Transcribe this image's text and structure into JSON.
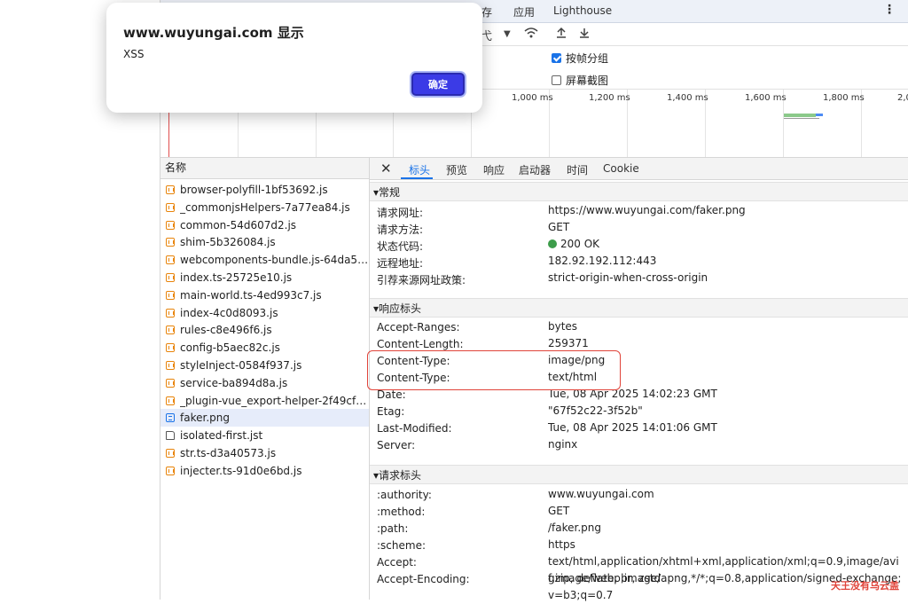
{
  "tabbar": {
    "tabs": [
      "存",
      "应用",
      "Lighthouse"
    ]
  },
  "options": {
    "group_by_frame": "按帧分组",
    "screenshots": "屏幕截图"
  },
  "timeline": {
    "ticks": [
      "1,000 ms",
      "1,200 ms",
      "1,400 ms",
      "1,600 ms",
      "1,800 ms",
      "2,0"
    ]
  },
  "request_list": {
    "header": "名称",
    "selected_index": 13,
    "items": [
      {
        "name": "browser-polyfill-1bf53692.js",
        "icon": "js-file-icon"
      },
      {
        "name": "_commonjsHelpers-7a77ea84.js",
        "icon": "js-file-icon"
      },
      {
        "name": "common-54d607d2.js",
        "icon": "js-file-icon"
      },
      {
        "name": "shim-5b326084.js",
        "icon": "js-file-icon"
      },
      {
        "name": "webcomponents-bundle.js-64da5ba...",
        "icon": "js-file-icon"
      },
      {
        "name": "index.ts-25725e10.js",
        "icon": "js-file-icon"
      },
      {
        "name": "main-world.ts-4ed993c7.js",
        "icon": "js-file-icon"
      },
      {
        "name": "index-4c0d8093.js",
        "icon": "js-file-icon"
      },
      {
        "name": "rules-c8e496f6.js",
        "icon": "js-file-icon"
      },
      {
        "name": "config-b5aec82c.js",
        "icon": "js-file-icon"
      },
      {
        "name": "styleInject-0584f937.js",
        "icon": "js-file-icon"
      },
      {
        "name": "service-ba894d8a.js",
        "icon": "js-file-icon"
      },
      {
        "name": "_plugin-vue_export-helper-2f49cf34...",
        "icon": "js-file-icon"
      },
      {
        "name": "faker.png",
        "icon": "document-icon"
      },
      {
        "name": "isolated-first.jst",
        "icon": "page-icon"
      },
      {
        "name": "str.ts-d3a40573.js",
        "icon": "js-file-icon"
      },
      {
        "name": "injecter.ts-91d0e6bd.js",
        "icon": "js-file-icon"
      }
    ]
  },
  "detail_tabs": [
    "标头",
    "预览",
    "响应",
    "启动器",
    "时间",
    "Cookie"
  ],
  "sections": {
    "general": {
      "title": "▾常规",
      "rows": [
        {
          "k": "请求网址:",
          "v": "https://www.wuyungai.com/faker.png"
        },
        {
          "k": "请求方法:",
          "v": "GET"
        },
        {
          "k": "状态代码:",
          "v": "200 OK"
        },
        {
          "k": "远程地址:",
          "v": "182.92.192.112:443"
        },
        {
          "k": "引荐来源网址政策:",
          "v": "strict-origin-when-cross-origin"
        }
      ]
    },
    "response": {
      "title": "▾响应标头",
      "rows": [
        {
          "k": "Accept-Ranges:",
          "v": "bytes"
        },
        {
          "k": "Content-Length:",
          "v": "259371"
        },
        {
          "k": "Content-Type:",
          "v": "image/png"
        },
        {
          "k": "Content-Type:",
          "v": "text/html"
        },
        {
          "k": "Date:",
          "v": "Tue, 08 Apr 2025 14:02:23 GMT"
        },
        {
          "k": "Etag:",
          "v": "\"67f52c22-3f52b\""
        },
        {
          "k": "Last-Modified:",
          "v": "Tue, 08 Apr 2025 14:01:06 GMT"
        },
        {
          "k": "Server:",
          "v": "nginx"
        }
      ]
    },
    "request": {
      "title": "▾请求标头",
      "rows": [
        {
          "k": ":authority:",
          "v": "www.wuyungai.com"
        },
        {
          "k": ":method:",
          "v": "GET"
        },
        {
          "k": ":path:",
          "v": "/faker.png"
        },
        {
          "k": ":scheme:",
          "v": "https"
        },
        {
          "k": "Accept:",
          "v": "text/html,application/xhtml+xml,application/xml;q=0.9,image/avif,image/webp,image/apng,*/*;q=0.8,application/signed-exchange;v=b3;q=0.7"
        },
        {
          "k": "Accept-Encoding:",
          "v": "gzip, deflate, br, zstd"
        }
      ]
    }
  },
  "dialog": {
    "title": "www.wuyungai.com 显示",
    "message": "XSS",
    "ok_label": "确定"
  },
  "watermark": "天王没有乌云盖",
  "colors": {
    "accent": "#1a73e8",
    "status_ok": "#3c9c4a",
    "highlight": "#e0443a",
    "dialog_button": "#3b3be6"
  }
}
